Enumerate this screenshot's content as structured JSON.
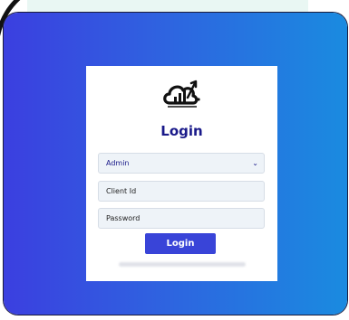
{
  "login": {
    "title": "Login",
    "role_select": {
      "value": "Admin",
      "options_visible": [
        "Admin"
      ]
    },
    "client_id": {
      "placeholder": "Client Id"
    },
    "password": {
      "placeholder": "Password"
    },
    "submit_label": "Login"
  },
  "icons": {
    "logo": "cloud-growth-chart-logo",
    "select_chevron": "chevron-down-icon"
  },
  "colors": {
    "gradient_start": "#3b3fe0",
    "gradient_end": "#1a8be0",
    "title": "#1a1a8a",
    "button": "#3944d8"
  }
}
